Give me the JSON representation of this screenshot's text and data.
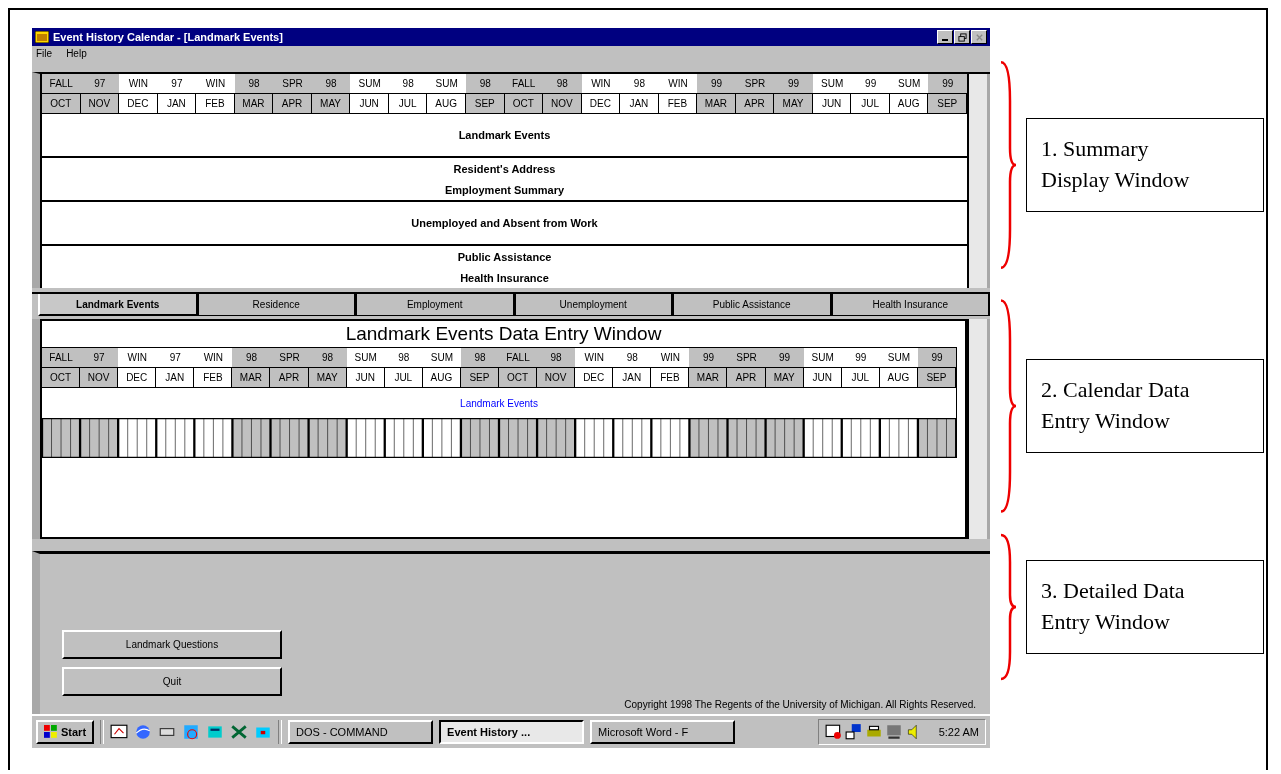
{
  "window": {
    "title": "Event History Calendar - [Landmark Events]"
  },
  "menu": [
    "File",
    "Help"
  ],
  "summary": {
    "calendar": [
      {
        "season": "FALL",
        "month": "OCT",
        "shaded": true
      },
      {
        "season": "97",
        "month": "NOV",
        "shaded": true
      },
      {
        "season": "WIN",
        "month": "DEC",
        "shaded": false
      },
      {
        "season": "97",
        "month": "JAN",
        "shaded": false
      },
      {
        "season": "WIN",
        "month": "FEB",
        "shaded": false
      },
      {
        "season": "98",
        "month": "MAR",
        "shaded": true
      },
      {
        "season": "SPR",
        "month": "APR",
        "shaded": true
      },
      {
        "season": "98",
        "month": "MAY",
        "shaded": true
      },
      {
        "season": "SUM",
        "month": "JUN",
        "shaded": false
      },
      {
        "season": "98",
        "month": "JUL",
        "shaded": false
      },
      {
        "season": "SUM",
        "month": "AUG",
        "shaded": false
      },
      {
        "season": "98",
        "month": "SEP",
        "shaded": true
      },
      {
        "season": "FALL",
        "month": "OCT",
        "shaded": true
      },
      {
        "season": "98",
        "month": "NOV",
        "shaded": true
      },
      {
        "season": "WIN",
        "month": "DEC",
        "shaded": false
      },
      {
        "season": "98",
        "month": "JAN",
        "shaded": false
      },
      {
        "season": "WIN",
        "month": "FEB",
        "shaded": false
      },
      {
        "season": "99",
        "month": "MAR",
        "shaded": true
      },
      {
        "season": "SPR",
        "month": "APR",
        "shaded": true
      },
      {
        "season": "99",
        "month": "MAY",
        "shaded": true
      },
      {
        "season": "SUM",
        "month": "JUN",
        "shaded": false
      },
      {
        "season": "99",
        "month": "JUL",
        "shaded": false
      },
      {
        "season": "SUM",
        "month": "AUG",
        "shaded": false
      },
      {
        "season": "99",
        "month": "SEP",
        "shaded": true
      }
    ],
    "blocks": [
      [
        "Landmark Events"
      ],
      [
        "Resident's Address",
        "Employment Summary"
      ],
      [
        "Unemployed and Absent from Work"
      ],
      [
        "Public Assistance",
        "Health Insurance"
      ]
    ]
  },
  "tabs": [
    {
      "label": "Landmark Events",
      "selected": true
    },
    {
      "label": "Residence",
      "selected": false
    },
    {
      "label": "Employment",
      "selected": false
    },
    {
      "label": "Unemployment",
      "selected": false
    },
    {
      "label": "Public Assistance",
      "selected": false
    },
    {
      "label": "Health Insurance",
      "selected": false
    }
  ],
  "entry": {
    "title": "Landmark Events Data Entry Window",
    "calendar": [
      {
        "season": "FALL",
        "month": "OCT",
        "shaded": true
      },
      {
        "season": "97",
        "month": "NOV",
        "shaded": true
      },
      {
        "season": "WIN",
        "month": "DEC",
        "shaded": false
      },
      {
        "season": "97",
        "month": "JAN",
        "shaded": false
      },
      {
        "season": "WIN",
        "month": "FEB",
        "shaded": false
      },
      {
        "season": "98",
        "month": "MAR",
        "shaded": true
      },
      {
        "season": "SPR",
        "month": "APR",
        "shaded": true
      },
      {
        "season": "98",
        "month": "MAY",
        "shaded": true
      },
      {
        "season": "SUM",
        "month": "JUN",
        "shaded": false
      },
      {
        "season": "98",
        "month": "JUL",
        "shaded": false
      },
      {
        "season": "SUM",
        "month": "AUG",
        "shaded": false
      },
      {
        "season": "98",
        "month": "SEP",
        "shaded": true
      },
      {
        "season": "FALL",
        "month": "OCT",
        "shaded": true
      },
      {
        "season": "98",
        "month": "NOV",
        "shaded": true
      },
      {
        "season": "WIN",
        "month": "DEC",
        "shaded": false
      },
      {
        "season": "98",
        "month": "JAN",
        "shaded": false
      },
      {
        "season": "WIN",
        "month": "FEB",
        "shaded": false
      },
      {
        "season": "99",
        "month": "MAR",
        "shaded": true
      },
      {
        "season": "SPR",
        "month": "APR",
        "shaded": true
      },
      {
        "season": "99",
        "month": "MAY",
        "shaded": true
      },
      {
        "season": "SUM",
        "month": "JUN",
        "shaded": false
      },
      {
        "season": "99",
        "month": "JUL",
        "shaded": false
      },
      {
        "season": "SUM",
        "month": "AUG",
        "shaded": false
      },
      {
        "season": "99",
        "month": "SEP",
        "shaded": true
      }
    ],
    "row_label": "Landmark Events"
  },
  "detail": {
    "buttons": [
      "Landmark Questions",
      "Quit"
    ],
    "copyright": "Copyright 1998  The Regents of the University of Michigan. All Rights Reserved."
  },
  "taskbar": {
    "start": "Start",
    "tasks": [
      {
        "label": "DOS - COMMAND",
        "selected": false
      },
      {
        "label": "Event History ...",
        "selected": true
      },
      {
        "label": "Microsoft Word - F",
        "selected": false
      }
    ],
    "clock": "5:22 AM"
  },
  "annotations": [
    "1.  Summary\nDisplay Window",
    "2. Calendar Data\nEntry Window",
    "3. Detailed Data\nEntry Window"
  ]
}
